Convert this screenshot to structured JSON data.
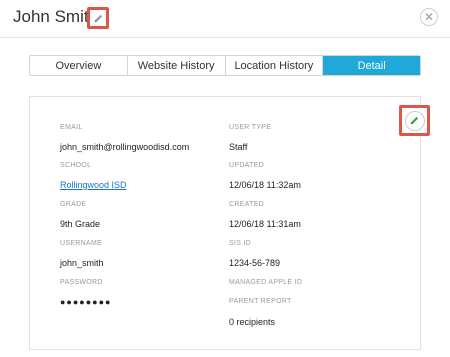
{
  "header": {
    "title": "John Smith",
    "edit_icon": "pencil-icon",
    "close_icon": "close-icon",
    "close_glyph": "✕"
  },
  "tabs": [
    {
      "label": "Overview",
      "active": false
    },
    {
      "label": "Website History",
      "active": false
    },
    {
      "label": "Location History",
      "active": false
    },
    {
      "label": "Detail",
      "active": true
    }
  ],
  "detail": {
    "edit_icon": "pencil-icon",
    "left": [
      {
        "label": "EMAIL",
        "value": "john_smith@rollingwoodisd.com"
      },
      {
        "label": "SCHOOL",
        "value": "Rollingwood ISD"
      },
      {
        "label": "GRADE",
        "value": "9th Grade"
      },
      {
        "label": "USERNAME",
        "value": "john_smith"
      },
      {
        "label": "PASSWORD",
        "value": "●●●●●●●●"
      }
    ],
    "right": [
      {
        "label": "USER TYPE",
        "value": "Staff"
      },
      {
        "label": "UPDATED",
        "value": "12/06/18 11:32am"
      },
      {
        "label": "CREATED",
        "value": "12/06/18 11:31am"
      },
      {
        "label": "SIS ID",
        "value": "1234-56-789"
      },
      {
        "label": "MANAGED APPLE ID",
        "value": ""
      },
      {
        "label": "PARENT REPORT",
        "value": "0 recipients"
      }
    ]
  },
  "colors": {
    "accent": "#20a8d8",
    "highlight": "#e05545",
    "edit_green": "#34a853",
    "link": "#1a73c8"
  }
}
